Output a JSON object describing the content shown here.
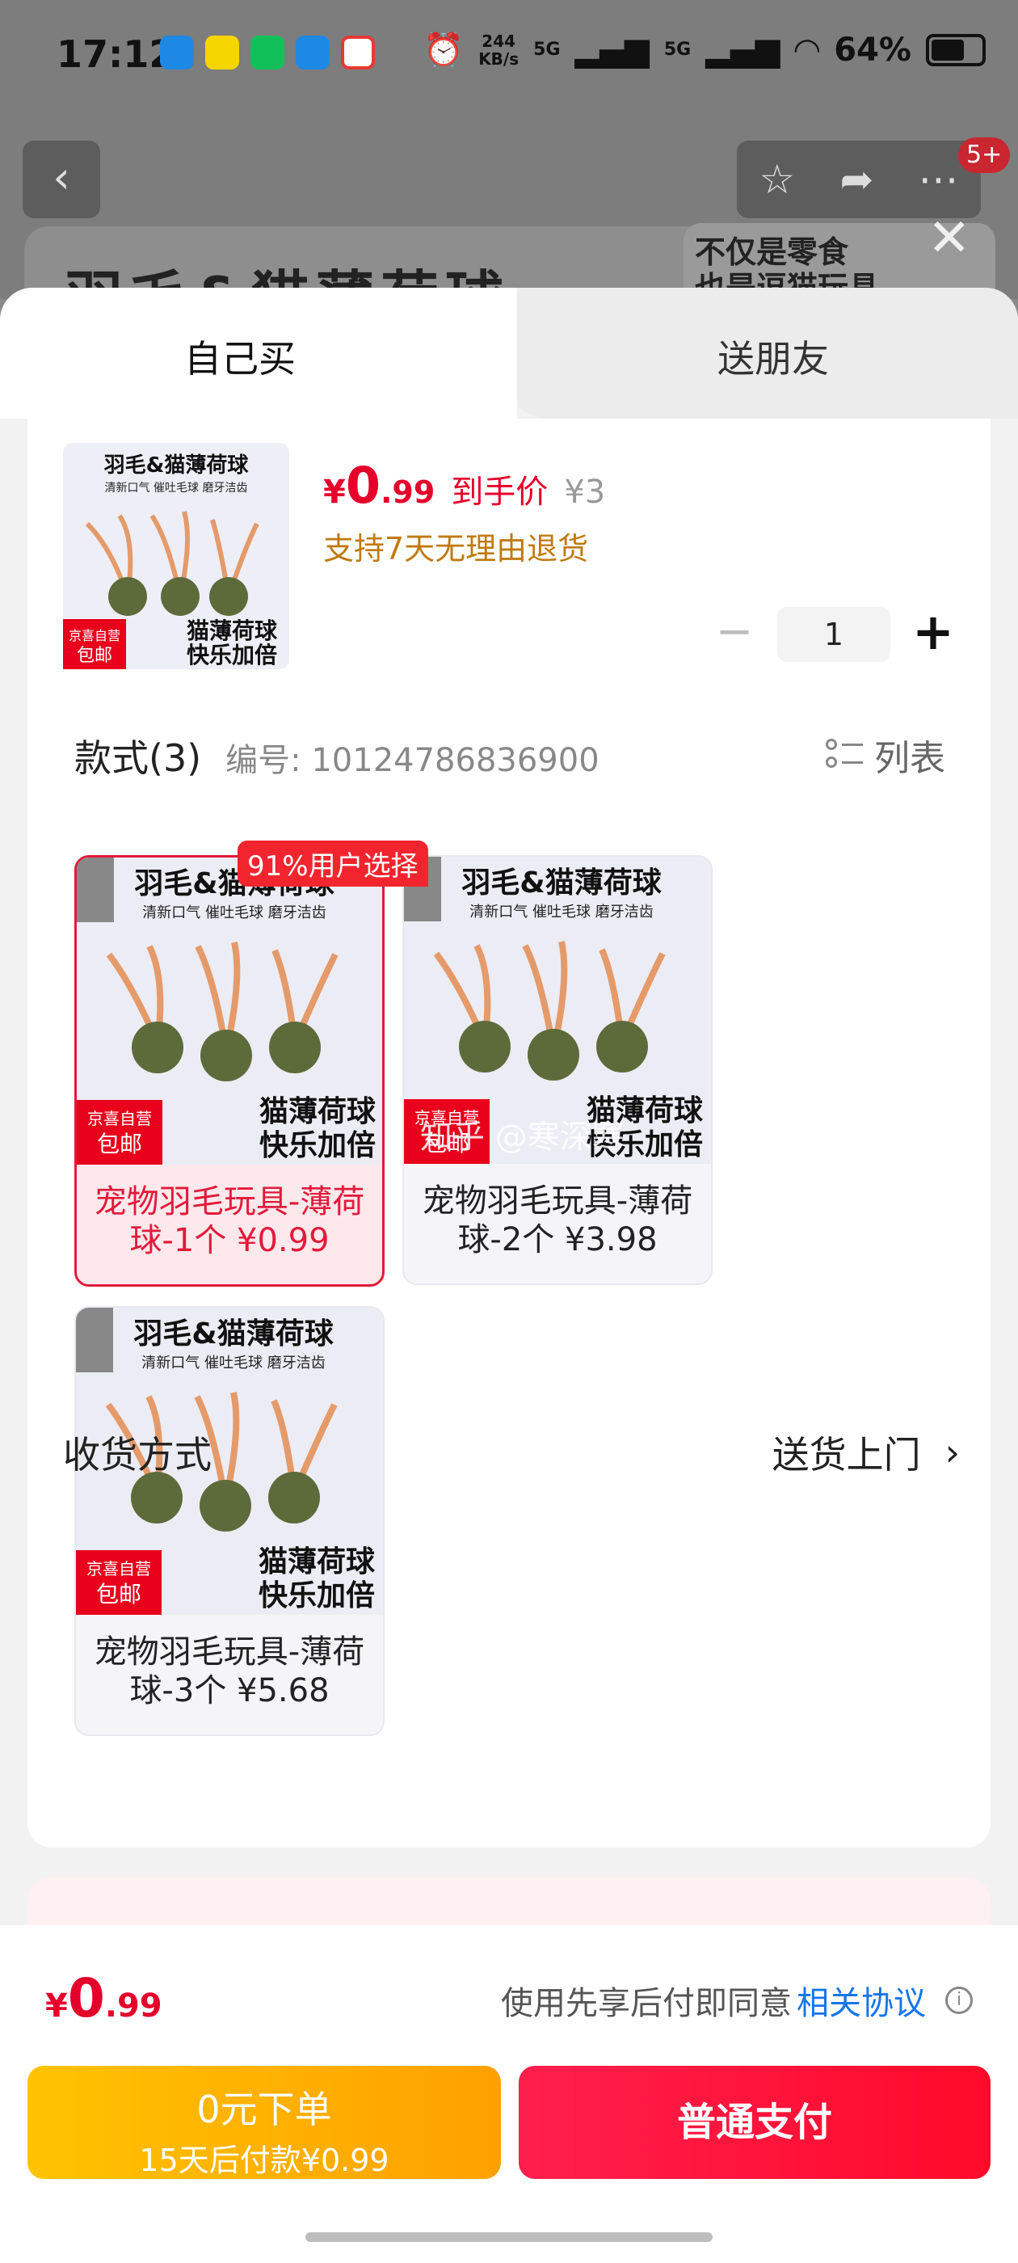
{
  "status_bar": {
    "time": "17:12",
    "net_speed_value": "244",
    "net_speed_unit": "KB/s",
    "signal1": "5G",
    "signal2": "5G",
    "battery": "64%",
    "app_icon_colors": [
      "#1e88e5",
      "#f6d600",
      "#12c05a",
      "#1e88e5",
      "#e53935"
    ]
  },
  "background_page": {
    "back_icon": "back-chevron-icon",
    "badge": "5+",
    "title": "羽毛&猫薄荷球",
    "promo_line1": "不仅是零食",
    "promo_line2": "也是逗猫玩具"
  },
  "tabs": [
    {
      "label": "自己买",
      "active": true
    },
    {
      "label": "送朋友",
      "active": false
    }
  ],
  "product": {
    "thumb_title": "羽毛&猫薄荷球",
    "thumb_sub": "清新口气 催吐毛球 磨牙洁齿",
    "thumb_caption1": "猫薄荷球",
    "thumb_caption2": "快乐加倍",
    "thumb_badge1": "京喜自营",
    "thumb_badge2": "包邮",
    "price_currency": "¥",
    "price_int": "0",
    "price_dec": ".99",
    "price_tag": "到手价",
    "original_price": "¥3",
    "returns": "支持7天无理由退货",
    "quantity": "1",
    "minus": "−",
    "plus": "+"
  },
  "styles": {
    "title": "款式(3)",
    "code": "编号: 10124786836900",
    "list_label": "列表",
    "choose_badge": "91%用户选择",
    "watermark": "知乎 @寒深寒",
    "options": [
      {
        "label": "宠物羽毛玩具-薄荷球-1个 ¥0.99",
        "selected": true
      },
      {
        "label": "宠物羽毛玩具-薄荷球-2个 ¥3.98",
        "selected": false
      },
      {
        "label": "宠物羽毛玩具-薄荷球-3个 ¥5.68",
        "selected": false
      }
    ]
  },
  "delivery": {
    "label": "收货方式",
    "value": "送货上门",
    "chevron": "›"
  },
  "bottom": {
    "price_currency": "¥",
    "price_int": "0",
    "price_dec": ".99",
    "agree_text": "使用先享后付即同意",
    "agree_link": "相关协议",
    "info": "i",
    "later_line1": "0元下单",
    "later_line2": "15天后付款¥0.99",
    "pay_label": "普通支付"
  },
  "colors": {
    "accent_red": "#e4002b",
    "returns_orange": "#c07a10",
    "link_blue": "#1676e8"
  }
}
